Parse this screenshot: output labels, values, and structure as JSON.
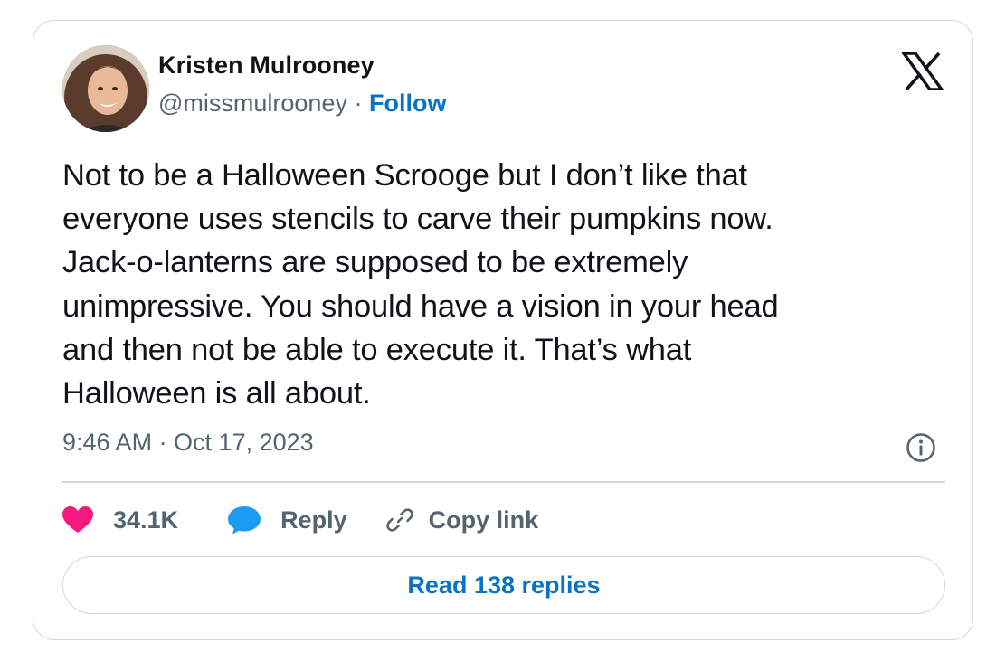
{
  "author": {
    "name": "Kristen Mulrooney",
    "handle": "@missmulrooney",
    "separator": "·",
    "follow_label": "Follow"
  },
  "tweet": {
    "text": "Not to be a Halloween Scrooge but I don’t like that\neveryone uses stencils to carve their pumpkins now.\nJack-o-lanterns are supposed to be extremely\nunimpressive. You should have a vision in your head\nand then not be able to execute it.  That’s what\nHalloween is all about.",
    "timestamp": "9:46 AM · Oct 17, 2023"
  },
  "actions": {
    "like_count": "34.1K",
    "reply_label": "Reply",
    "copy_link_label": "Copy link"
  },
  "read_replies_label": "Read 138 replies",
  "icons": {
    "brand": "x-logo-icon",
    "info": "info-icon",
    "like": "heart-icon",
    "reply": "speech-bubble-icon",
    "copy": "link-icon"
  },
  "colors": {
    "like": "#f91880",
    "reply": "#1d9bf0",
    "link_blue": "#0a73c4",
    "muted": "#536471",
    "text": "#0f1419",
    "border": "#cfd9de"
  }
}
